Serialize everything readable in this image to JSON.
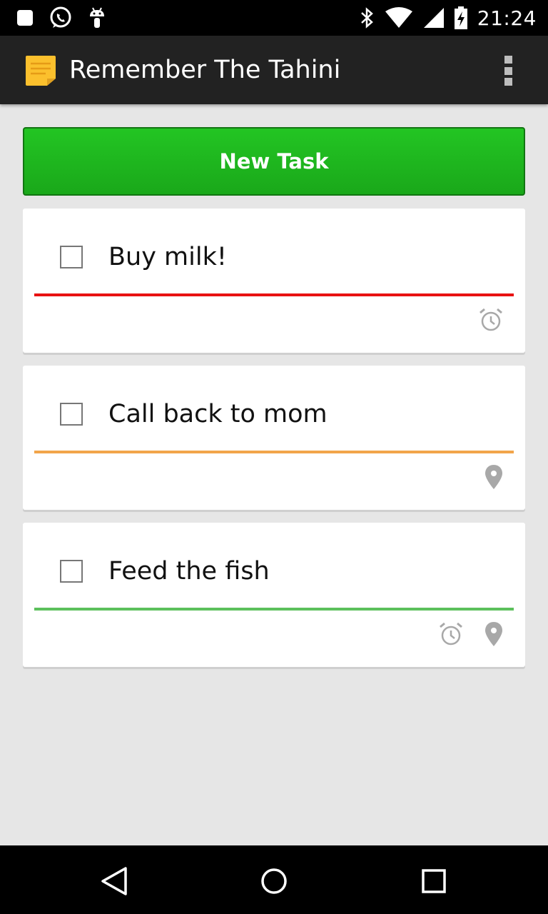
{
  "status_bar": {
    "time": "21:24",
    "left_icons": [
      "notification-square-icon",
      "whatsapp-icon",
      "android-icon"
    ],
    "right_icons": [
      "bluetooth-icon",
      "wifi-icon",
      "signal-icon",
      "battery-charging-icon"
    ]
  },
  "app_bar": {
    "title": "Remember The Tahini",
    "icon": "sticky-note-icon",
    "overflow_icon": "overflow-menu-icon"
  },
  "new_task_button": {
    "label": "New Task",
    "color": "#1fb81f"
  },
  "tasks": [
    {
      "title": "Buy milk!",
      "checked": false,
      "priority_color": "#e81111",
      "icons": [
        "alarm-icon"
      ]
    },
    {
      "title": "Call back to mom",
      "checked": false,
      "priority_color": "#f2a54a",
      "icons": [
        "location-pin-icon"
      ]
    },
    {
      "title": "Feed the fish",
      "checked": false,
      "priority_color": "#5cc05c",
      "icons": [
        "alarm-icon",
        "location-pin-icon"
      ]
    }
  ],
  "nav_bar": {
    "buttons": [
      "back-icon",
      "home-icon",
      "recents-icon"
    ]
  },
  "colors": {
    "background": "#e6e6e6",
    "app_bar": "#222222",
    "icon_gray": "#a8a8a8"
  }
}
